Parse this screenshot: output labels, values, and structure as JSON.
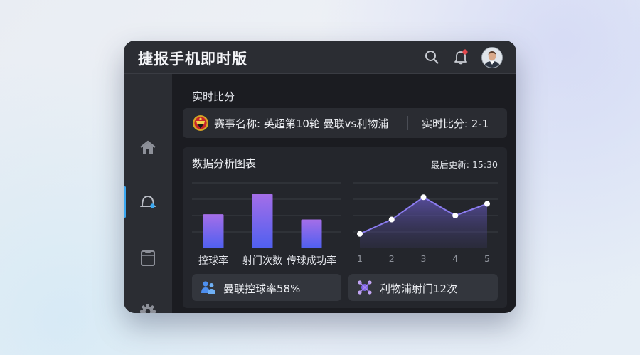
{
  "app": {
    "title": "捷报手机即时版"
  },
  "header": {
    "notification_count": 1
  },
  "sidebar": {
    "items": [
      {
        "icon": "home-icon"
      },
      {
        "icon": "live-user-icon",
        "active": true
      },
      {
        "icon": "clipboard-icon"
      },
      {
        "icon": "gear-icon"
      }
    ]
  },
  "live": {
    "section_title": "实时比分",
    "match_label": "赛事名称: 英超第10轮 曼联vs利物浦",
    "score_label": "实时比分: 2-1"
  },
  "analysis": {
    "title": "数据分析图表",
    "updated": "最后更新: 15:30",
    "stat_left": "曼联控球率58%",
    "stat_right": "利物浦射门12次"
  },
  "colors": {
    "accent": "#3aa7f0",
    "bar_top": "#a46ee8",
    "bar_bottom": "#4f60f0",
    "line": "#8b7cf0"
  },
  "chart_data": [
    {
      "type": "bar",
      "categories": [
        "控球率",
        "射门次数",
        "传球成功率"
      ],
      "values": [
        52,
        83,
        44
      ],
      "ylim": [
        0,
        100
      ],
      "grid": true
    },
    {
      "type": "area",
      "x": [
        1,
        2,
        3,
        4,
        5
      ],
      "values": [
        22,
        44,
        78,
        50,
        68
      ],
      "ylim": [
        0,
        100
      ],
      "grid": true
    }
  ]
}
